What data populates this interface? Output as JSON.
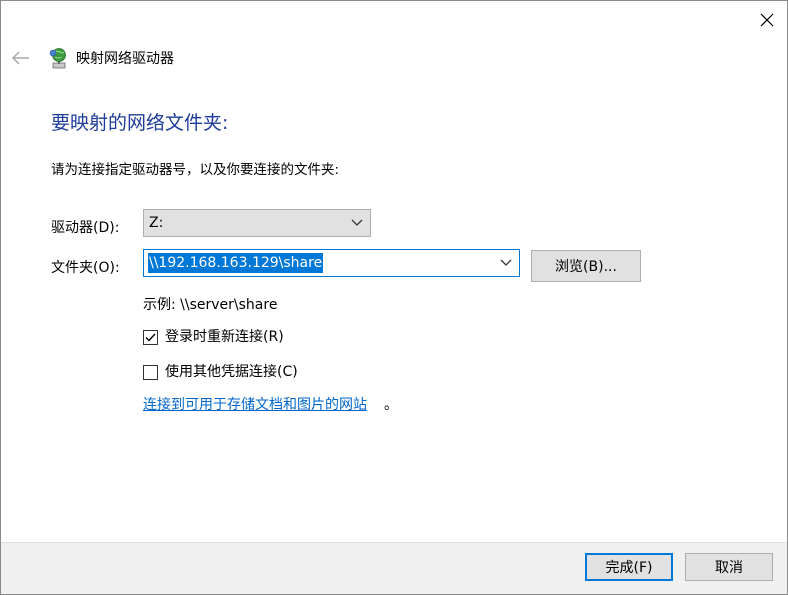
{
  "window": {
    "title": "映射网络驱动器",
    "icons": {
      "back": "back-arrow-icon",
      "close": "close-icon",
      "network": "network-drive-icon"
    }
  },
  "main": {
    "heading": "要映射的网络文件夹:",
    "instruction": "请为连接指定驱动器号，以及你要连接的文件夹:",
    "drive": {
      "label": "驱动器(D):",
      "value": "Z:"
    },
    "folder": {
      "label": "文件夹(O):",
      "value": "\\\\192.168.163.129\\share"
    },
    "browse_label": "浏览(B)...",
    "example": "示例: \\\\server\\share",
    "reconnect": {
      "label": "登录时重新连接(R)",
      "checked": true
    },
    "other_credentials": {
      "label": "使用其他凭据连接(C)",
      "checked": false
    },
    "link_text": "连接到可用于存储文档和图片的网站",
    "link_suffix": "。"
  },
  "footer": {
    "finish_label": "完成(F)",
    "cancel_label": "取消"
  },
  "colors": {
    "accent": "#0078d7",
    "heading": "#1e3c9a",
    "link": "#0066cc"
  }
}
